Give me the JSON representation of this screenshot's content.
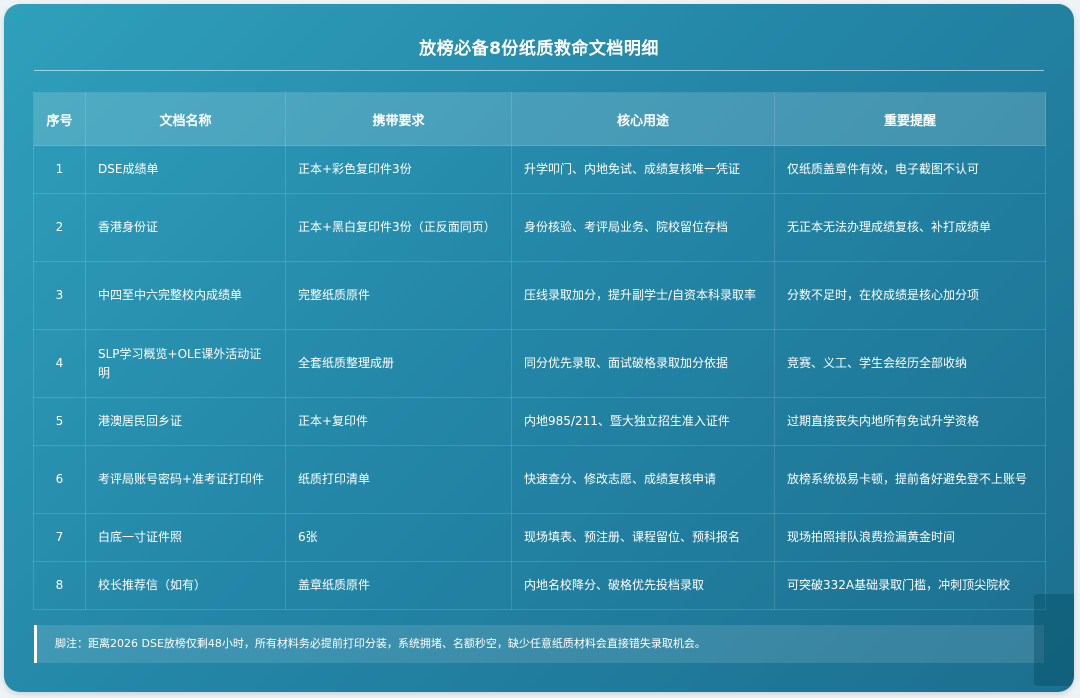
{
  "title": "放榜必备8份纸质救命文档明细",
  "table": {
    "headers": [
      "序号",
      "文档名称",
      "携带要求",
      "核心用途",
      "重要提醒"
    ],
    "rows": [
      {
        "no": "1",
        "name": "DSE成绩单",
        "requirement": "正本+彩色复印件3份",
        "usage": "升学叩门、内地免试、成绩复核唯一凭证",
        "reminder": "仅纸质盖章件有效，电子截图不认可"
      },
      {
        "no": "2",
        "name": "香港身份证",
        "requirement": "正本+黑白复印件3份（正反面同页）",
        "usage": "身份核验、考评局业务、院校留位存档",
        "reminder": "无正本无法办理成绩复核、补打成绩单"
      },
      {
        "no": "3",
        "name": "中四至中六完整校内成绩单",
        "requirement": "完整纸质原件",
        "usage": "压线录取加分，提升副学士/自资本科录取率",
        "reminder": "分数不足时，在校成绩是核心加分项"
      },
      {
        "no": "4",
        "name": "SLP学习概览+OLE课外活动证明",
        "requirement": "全套纸质整理成册",
        "usage": "同分优先录取、面试破格录取加分依据",
        "reminder": "竞赛、义工、学生会经历全部收纳"
      },
      {
        "no": "5",
        "name": "港澳居民回乡证",
        "requirement": "正本+复印件",
        "usage": "内地985/211、暨大独立招生准入证件",
        "reminder": "过期直接丧失内地所有免试升学资格"
      },
      {
        "no": "6",
        "name": "考评局账号密码+准考证打印件",
        "requirement": "纸质打印清单",
        "usage": "快速查分、修改志愿、成绩复核申请",
        "reminder": "放榜系统极易卡顿，提前备好避免登不上账号"
      },
      {
        "no": "7",
        "name": "白底一寸证件照",
        "requirement": "6张",
        "usage": "现场填表、预注册、课程留位、预科报名",
        "reminder": "现场拍照排队浪费捡漏黄金时间"
      },
      {
        "no": "8",
        "name": "校长推荐信（如有）",
        "requirement": "盖章纸质原件",
        "usage": "内地名校降分、破格优先投档录取",
        "reminder": "可突破332A基础录取门槛，冲刺顶尖院校"
      }
    ]
  },
  "footnote": "脚注：距离2026 DSE放榜仅剩48小时，所有材料务必提前打印分装，系统拥堵、名额秒空，缺少任意纸质材料会直接错失录取机会。"
}
